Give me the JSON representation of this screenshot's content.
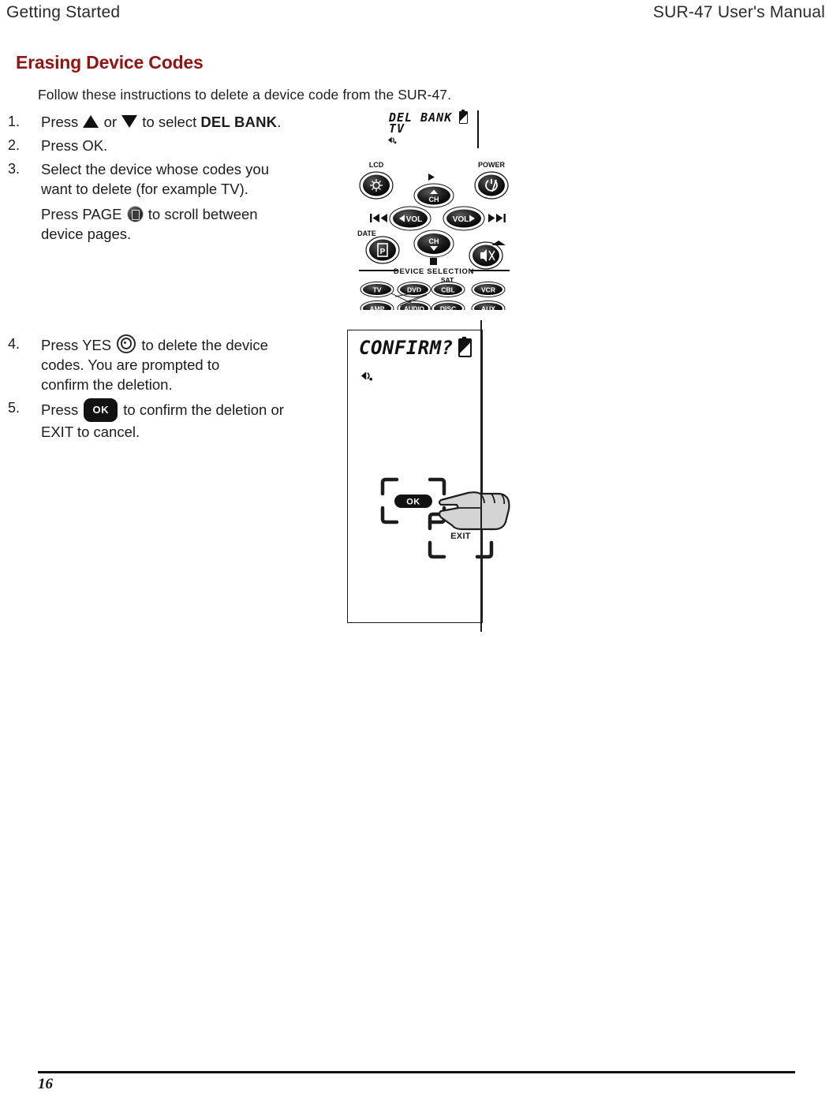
{
  "header": {
    "left": "Getting Started",
    "right": "SUR-47 User's Manual"
  },
  "heading": {
    "text": "Erasing Device Codes",
    "color": "#8f1414"
  },
  "intro": "Follow these instructions to delete a device code from the SUR-47.",
  "steps_group_1": [
    {
      "number": "1.",
      "parts": {
        "pre": "Press ",
        "mid": " or ",
        "post": " to select ",
        "lcd_label": "DEL  BANK",
        "tail": "."
      },
      "icons": [
        "triangle-up-icon",
        "triangle-down-icon"
      ]
    },
    {
      "number": "2.",
      "text": "Press OK."
    },
    {
      "number": "3.",
      "line1": "Select the device whose codes you",
      "line2": "want to delete (for example TV).",
      "sub_pre": "Press PAGE ",
      "sub_post": " to scroll between",
      "sub_line2": "device pages.",
      "icon": "page-button-icon"
    }
  ],
  "steps_group_2": [
    {
      "number": "4.",
      "pre": "Press YES ",
      "post": " to delete the device",
      "line2": "codes. You are prompted to",
      "line3": "confirm the deletion.",
      "icon": "yes-button-icon"
    },
    {
      "number": "5.",
      "pre": "Press ",
      "badge": "OK",
      "post": " to confirm the deletion or",
      "line2": "EXIT to cancel."
    }
  ],
  "figure_lcd_delbank": {
    "line1": "DEL BANK",
    "line2": "TV",
    "battery_icon": "battery-icon",
    "signal_icon": "signal-icon"
  },
  "figure_remote": {
    "labels": {
      "lcd": "LCD",
      "power": "POWER",
      "date": "DATE",
      "device_selection": "DEVICE SELECTION",
      "sat": "SAT"
    },
    "buttons": {
      "ch_up": "CH",
      "ch_down": "CH",
      "vol_left": "VOL",
      "vol_right": "VOL"
    },
    "device_row_1": [
      "TV",
      "DVD",
      "CBL",
      "VCR"
    ],
    "device_row_2": [
      "AMP",
      "AUDIO",
      "DISC",
      "AUX"
    ]
  },
  "figure_confirm_panel": {
    "display_text": "CONFIRM?",
    "battery_icon": "battery-icon",
    "signal_icon": "signal-icon",
    "ok_button": "OK",
    "exit_button": "EXIT",
    "hand_icon": "pointing-hand-icon"
  },
  "footer": {
    "page_number": "16"
  }
}
